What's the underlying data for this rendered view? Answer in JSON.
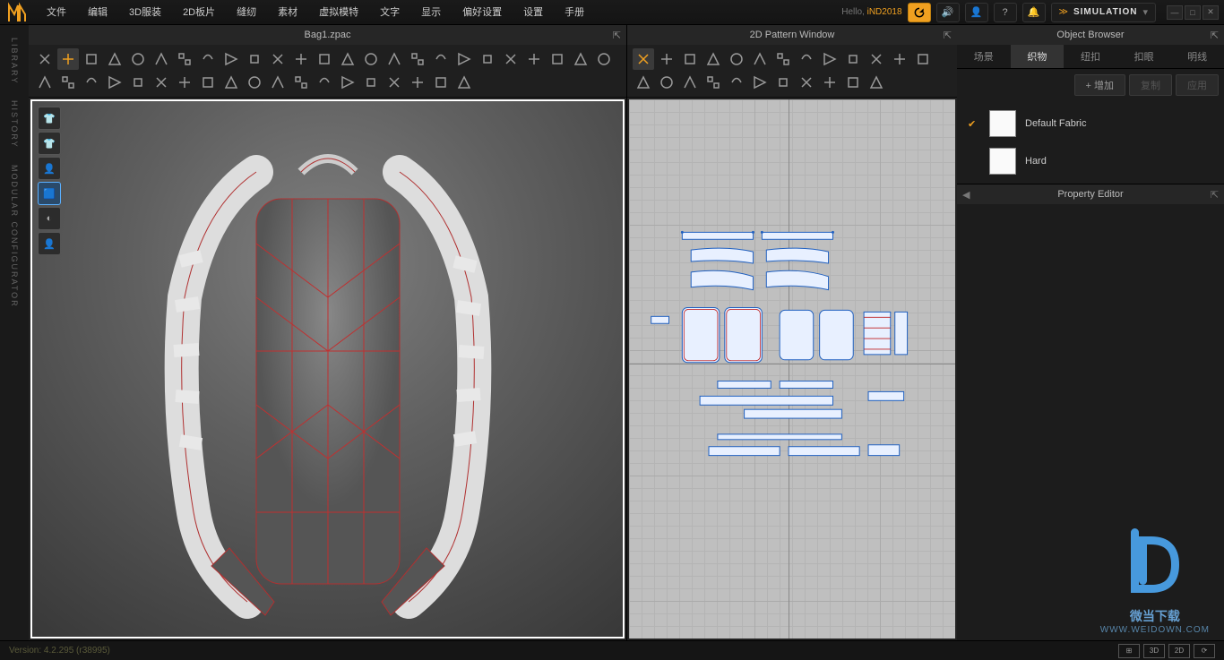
{
  "menu": [
    "文件",
    "编辑",
    "3D服装",
    "2D板片",
    "缝纫",
    "素材",
    "虚拟模特",
    "文字",
    "显示",
    "偏好设置",
    "设置",
    "手册"
  ],
  "hello_prefix": "Hello,",
  "user": "iND2018",
  "mode": "SIMULATION",
  "panel_3d_title": "Bag1.zpac",
  "panel_2d_title": "2D Pattern Window",
  "object_browser_title": "Object Browser",
  "property_editor_title": "Property Editor",
  "left_rail": [
    "LIBRARY",
    "HISTORY",
    "MODULAR CONFIGURATOR"
  ],
  "ob_tabs": [
    "场景",
    "织物",
    "纽扣",
    "扣眼",
    "明线"
  ],
  "ob_active_tab": 1,
  "ob_actions": {
    "add": "+ 增加",
    "copy": "复制",
    "apply": "应用"
  },
  "fabrics": [
    {
      "name": "Default Fabric",
      "selected": true
    },
    {
      "name": "Hard",
      "selected": false
    }
  ],
  "version": "Version: 4.2.295 (r38995)",
  "status_views": [
    "⊞",
    "3D",
    "2D",
    "⟳"
  ],
  "watermark": {
    "text": "微当下载",
    "url": "WWW.WEIDOWN.COM"
  }
}
